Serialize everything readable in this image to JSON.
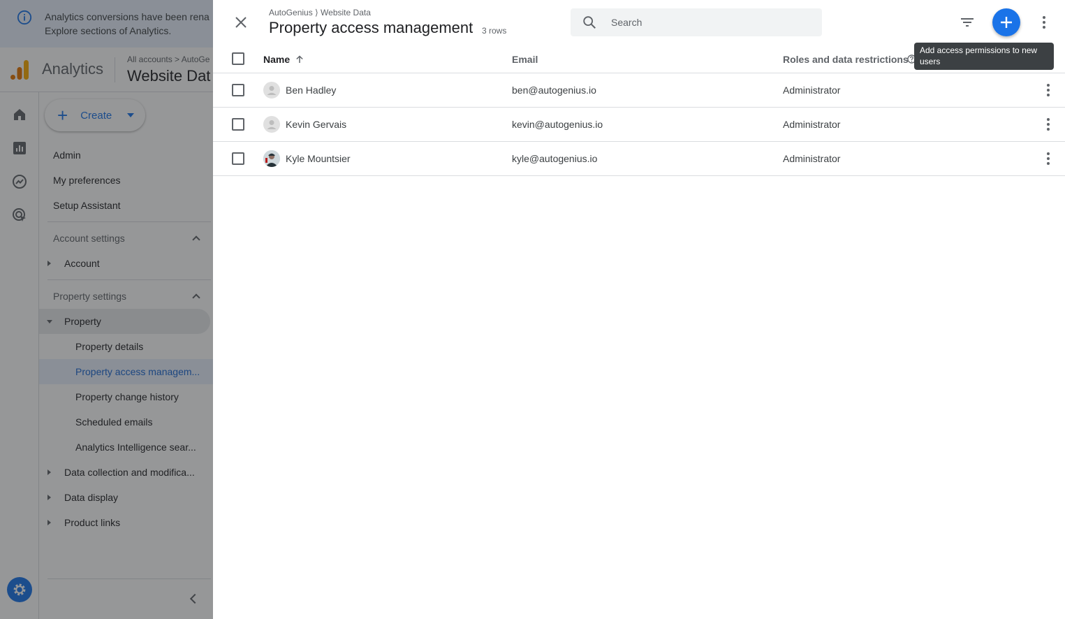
{
  "banner": {
    "line1": "Analytics conversions have been rena",
    "line2": "Explore sections of Analytics."
  },
  "header": {
    "brand": "Analytics",
    "breadcrumb": "All accounts > AutoGe",
    "property_title": "Website Dat"
  },
  "nav": {
    "create_label": "Create",
    "admin": "Admin",
    "my_preferences": "My preferences",
    "setup_assistant": "Setup Assistant",
    "account_settings": "Account settings",
    "account": "Account",
    "property_settings": "Property settings",
    "property": "Property",
    "property_details": "Property details",
    "property_access": "Property access managem...",
    "property_change_history": "Property change history",
    "scheduled_emails": "Scheduled emails",
    "analytics_intelligence": "Analytics Intelligence sear...",
    "data_collection": "Data collection and modifica...",
    "data_display": "Data display",
    "product_links": "Product links"
  },
  "panel": {
    "breadcrumb": "AutoGenius ⟩ Website Data",
    "title": "Property access management",
    "row_count": "3 rows",
    "search_placeholder": "Search",
    "tooltip": "Add access permissions to new users",
    "columns": {
      "name": "Name",
      "email": "Email",
      "roles": "Roles and data restrictions"
    },
    "rows": [
      {
        "name": "Ben Hadley",
        "email": "ben@autogenius.io",
        "role": "Administrator"
      },
      {
        "name": "Kevin Gervais",
        "email": "kevin@autogenius.io",
        "role": "Administrator"
      },
      {
        "name": "Kyle Mountsier",
        "email": "kyle@autogenius.io",
        "role": "Administrator"
      }
    ]
  },
  "colors": {
    "accent": "#1a73e8",
    "selected_bg": "#e8f0fe",
    "tooltip_bg": "#3c4043",
    "analytics_orange": "#f9ab00",
    "analytics_dark_orange": "#e37400"
  }
}
